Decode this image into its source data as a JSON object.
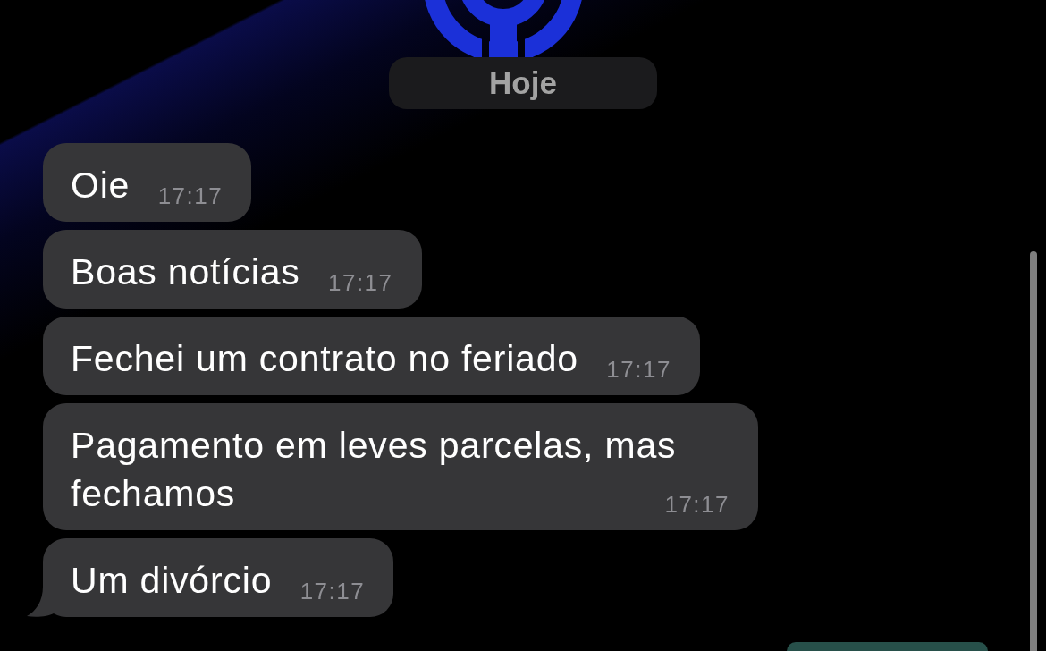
{
  "date_divider": {
    "label": "Hoje"
  },
  "messages": [
    {
      "kind": "incoming",
      "text": "Oie",
      "time": "17:17",
      "tail": false
    },
    {
      "kind": "incoming",
      "text": "Boas notícias",
      "time": "17:17",
      "tail": false
    },
    {
      "kind": "incoming",
      "text": "Fechei um contrato no feriado",
      "time": "17:17",
      "tail": false
    },
    {
      "kind": "incoming",
      "text": "Pagamento em leves parcelas, mas fechamos",
      "time": "17:17",
      "tail": false
    },
    {
      "kind": "incoming",
      "text": "Um divórcio",
      "time": "17:17",
      "tail": true
    },
    {
      "kind": "outgoing"
    }
  ]
}
